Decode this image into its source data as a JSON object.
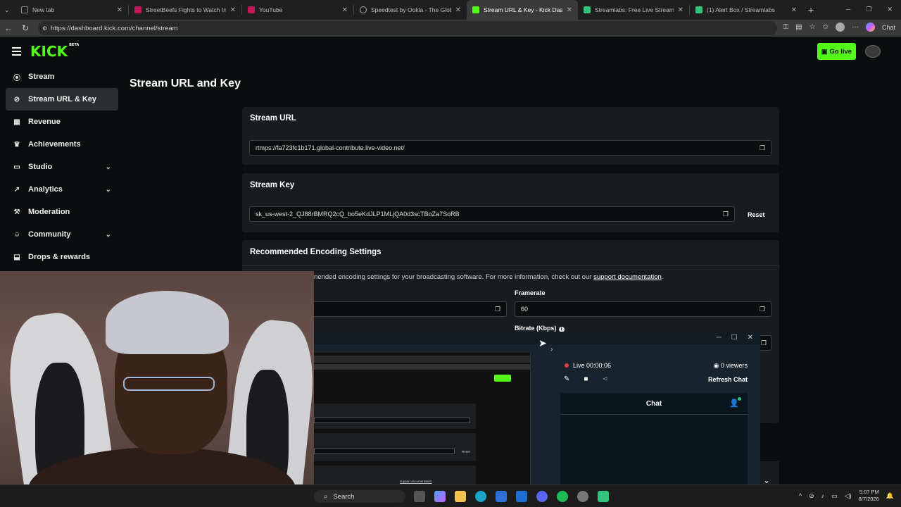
{
  "browser": {
    "tabs": [
      {
        "label": "New tab",
        "color": "#5f6368"
      },
      {
        "label": "StreetBeefs Fights to Watch Inste",
        "color": "#c2185b"
      },
      {
        "label": "YouTube",
        "color": "#c2185b"
      },
      {
        "label": "Speedtest by Ookla - The Global B",
        "color": "#555555"
      },
      {
        "label": "Stream URL & Key - Kick Dashboa",
        "color": "#53fc18"
      },
      {
        "label": "Streamlabs: Free Live Streaming A",
        "color": "#31c27c"
      },
      {
        "label": "(1) Alert Box / Streamlabs",
        "color": "#31c27c"
      }
    ],
    "url": "https://dashboard.kick.com/channel/stream",
    "chat_label": "Chat"
  },
  "header": {
    "logo": "KICK",
    "logo_badge": "BETA",
    "go_live": "Go live"
  },
  "sidebar": {
    "items": [
      {
        "label": "Stream",
        "icon": "stream-icon"
      },
      {
        "label": "Stream URL & Key",
        "icon": "link-icon"
      },
      {
        "label": "Revenue",
        "icon": "revenue-icon"
      },
      {
        "label": "Achievements",
        "icon": "trophy-icon"
      },
      {
        "label": "Studio",
        "icon": "studio-icon"
      },
      {
        "label": "Analytics",
        "icon": "analytics-icon"
      },
      {
        "label": "Moderation",
        "icon": "wrench-icon"
      },
      {
        "label": "Community",
        "icon": "community-icon"
      },
      {
        "label": "Drops & rewards",
        "icon": "drops-icon"
      }
    ]
  },
  "main": {
    "title": "Stream URL and Key",
    "stream_url": {
      "title": "Stream URL",
      "value": "rtmps://fa723fc1b171.global-contribute.live-video.net/"
    },
    "stream_key": {
      "title": "Stream Key",
      "value": "sk_us-west-2_QJ88rBMRQ2cQ_bo5eKdJLP1MLjQA0d3scTBoZa7SoRB",
      "reset": "Reset"
    },
    "encoding": {
      "title": "Recommended Encoding Settings",
      "description": "nended encoding settings for your broadcasting software. For more information, check out our ",
      "link": "support documentation",
      "framerate_label": "Framerate",
      "framerate_value": "60",
      "bitrate_label": "Bitrate (Kbps)"
    }
  },
  "streamlabs": {
    "live_label": "Live",
    "live_time": "00:00:06",
    "viewers": "0 viewers",
    "refresh_chat": "Refresh Chat",
    "chat_title": "Chat",
    "preview": {
      "mini_link": "support documentation",
      "mini_reset": "Reset"
    }
  },
  "taskbar": {
    "search": "Search",
    "time": "5:07 PM",
    "date": "8/7/2026"
  }
}
